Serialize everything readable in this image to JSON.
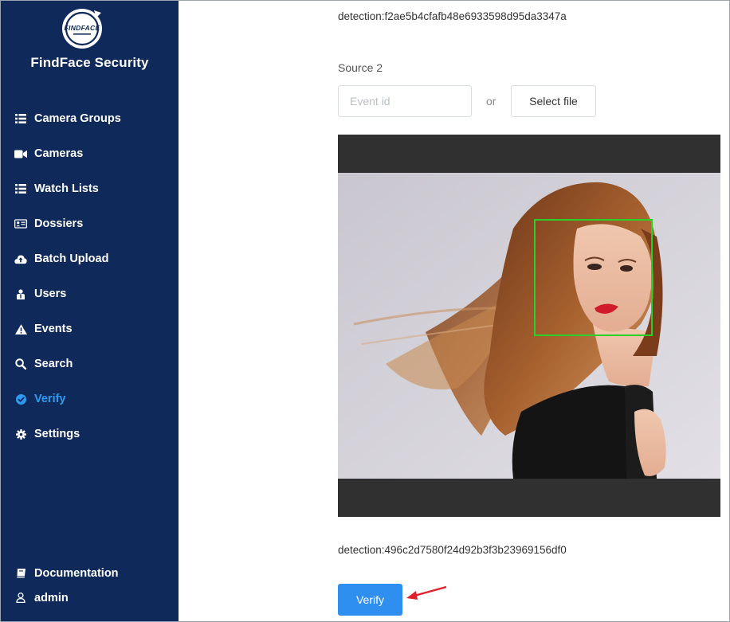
{
  "app": {
    "logo_text": "FINDFACE",
    "title": "FindFace Security"
  },
  "sidebar": {
    "items": [
      {
        "label": "Camera Groups",
        "icon": "list-icon"
      },
      {
        "label": "Cameras",
        "icon": "video-camera-icon"
      },
      {
        "label": "Watch Lists",
        "icon": "list-icon"
      },
      {
        "label": "Dossiers",
        "icon": "id-card-icon"
      },
      {
        "label": "Batch Upload",
        "icon": "cloud-upload-icon"
      },
      {
        "label": "Users",
        "icon": "users-icon"
      },
      {
        "label": "Events",
        "icon": "warning-icon"
      },
      {
        "label": "Search",
        "icon": "search-icon"
      },
      {
        "label": "Verify",
        "icon": "check-circle-icon",
        "active": true
      },
      {
        "label": "Settings",
        "icon": "gear-icon"
      }
    ],
    "bottom": [
      {
        "label": "Documentation",
        "icon": "book-icon"
      },
      {
        "label": "admin",
        "icon": "user-icon"
      }
    ],
    "active_color": "#2f9bf0",
    "background": "#0f2a5a"
  },
  "main": {
    "detection_top": "detection:f2ae5b4cfafb48e6933598d95da3347a",
    "source_label": "Source 2",
    "event_placeholder": "Event id",
    "event_value": "",
    "or_label": "or",
    "select_file_label": "Select file",
    "detection_bottom": "detection:496c2d7580f24d92b3f3b23969156df0",
    "verify_label": "Verify",
    "face_box_color": "#28d028",
    "accent": "#2f8ff0"
  }
}
